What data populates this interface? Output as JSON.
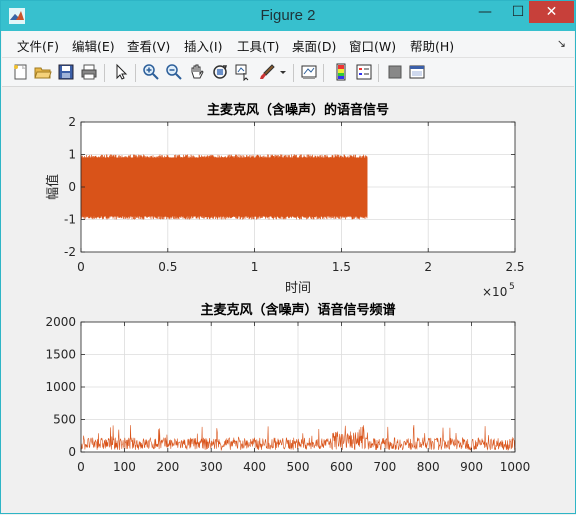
{
  "window": {
    "title": "Figure 2",
    "minimize": "—",
    "maximize": "☐",
    "close": "✕"
  },
  "menu": [
    "文件(F)",
    "编辑(E)",
    "查看(V)",
    "插入(I)",
    "工具(T)",
    "桌面(D)",
    "窗口(W)",
    "帮助(H)"
  ],
  "toolbar": [
    "new-figure-icon",
    "open-file-icon",
    "save-icon",
    "print-icon",
    "pointer-icon",
    "zoom-in-icon",
    "zoom-out-icon",
    "pan-hand-icon",
    "rotate-3d-icon",
    "data-cursor-icon",
    "brush-icon",
    "brush-dropdown-icon",
    "link-plot-icon",
    "colorbar-icon",
    "legend-icon",
    "hide-plot-tools-icon",
    "show-plot-tools-icon"
  ],
  "colors": {
    "signal": "#d95319",
    "grid": "#dcdcdc",
    "titlebar": "#37c0ce"
  },
  "chart_data": [
    {
      "type": "line",
      "title": "主麦克风（含噪声）的语音信号",
      "xlabel": "时间",
      "ylabel": "幅值",
      "xlim": [
        0,
        250000
      ],
      "ylim": [
        -2,
        2
      ],
      "x_ticks": [
        "0",
        "0.5",
        "1",
        "1.5",
        "2",
        "2.5"
      ],
      "x_exponent": "×10",
      "x_exponent_power": "5",
      "y_ticks": [
        "2",
        "1",
        "0",
        "-1",
        "-2"
      ],
      "grid": true,
      "series": [
        {
          "x_start": 0,
          "x_end": 165000,
          "y_min": -1,
          "y_max": 1
        }
      ]
    },
    {
      "type": "line",
      "title": "主麦克风（含噪声）语音信号频谱",
      "xlabel": "",
      "ylabel": "",
      "xlim": [
        0,
        1000
      ],
      "ylim": [
        0,
        2000
      ],
      "x_ticks": [
        "0",
        "100",
        "200",
        "300",
        "400",
        "500",
        "600",
        "700",
        "800",
        "900",
        "1000"
      ],
      "y_ticks": [
        "2000",
        "1500",
        "1000",
        "500",
        "0"
      ],
      "grid": true,
      "series": [
        {
          "baseline": 120,
          "peak_max": 420,
          "noise_floor": 30,
          "peak_region": [
            580,
            660
          ]
        }
      ]
    }
  ]
}
